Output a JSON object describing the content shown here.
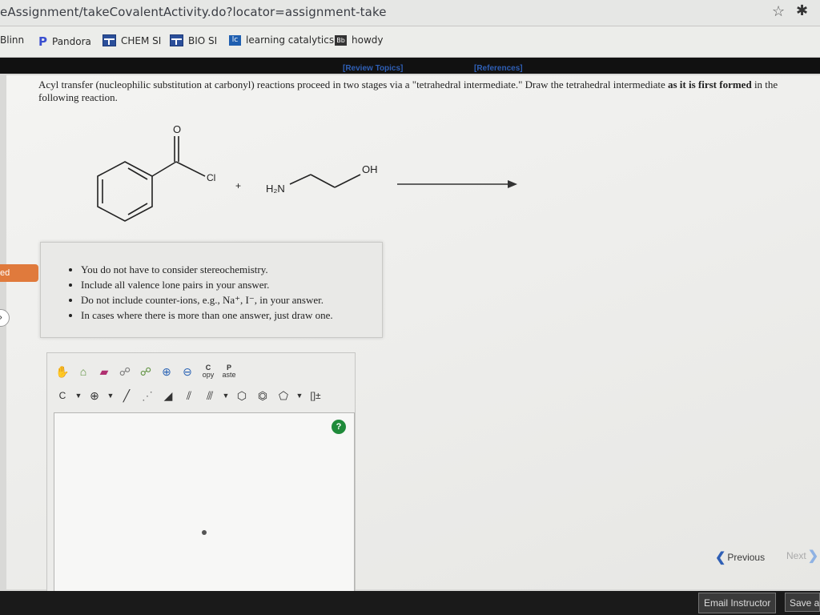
{
  "browser": {
    "url": "eAssignment/takeCovalentActivity.do?locator=assignment-take"
  },
  "bookmarks": [
    {
      "label": "Blinn"
    },
    {
      "label": "Pandora"
    },
    {
      "label": "CHEM SI"
    },
    {
      "label": "BIO SI"
    },
    {
      "label": "learning catalytics",
      "icon": "lc"
    },
    {
      "label": "howdy",
      "icon": "Bb"
    }
  ],
  "links": {
    "review": "[Review Topics]",
    "references": "[References]"
  },
  "question": {
    "text1": "Acyl transfer (nucleophilic substitution at carbonyl) reactions proceed in two stages via a \"tetrahedral intermediate.\" Draw the tetrahedral intermediate ",
    "bold1": "as it is first formed",
    "text2": " in the following reaction."
  },
  "reaction": {
    "o": "O",
    "cl": "Cl",
    "plus": "+",
    "h2n": "H₂N",
    "oh": "OH"
  },
  "notes": [
    "You do not have to consider stereochemistry.",
    "Include all valence lone pairs in your answer.",
    "Do not include counter-ions, e.g., Na⁺, I⁻, in your answer.",
    "In cases where there is more than one answer, just draw one."
  ],
  "editor": {
    "copy_c": "C",
    "copy_label": "opy",
    "paste_p": "P",
    "paste_label": "aste",
    "element": "C",
    "help": "?"
  },
  "sidebar": {
    "tab_label": "ed"
  },
  "nav": {
    "previous": "Previous",
    "next": "Next"
  },
  "footer": {
    "email": "Email Instructor",
    "save": "Save an"
  }
}
